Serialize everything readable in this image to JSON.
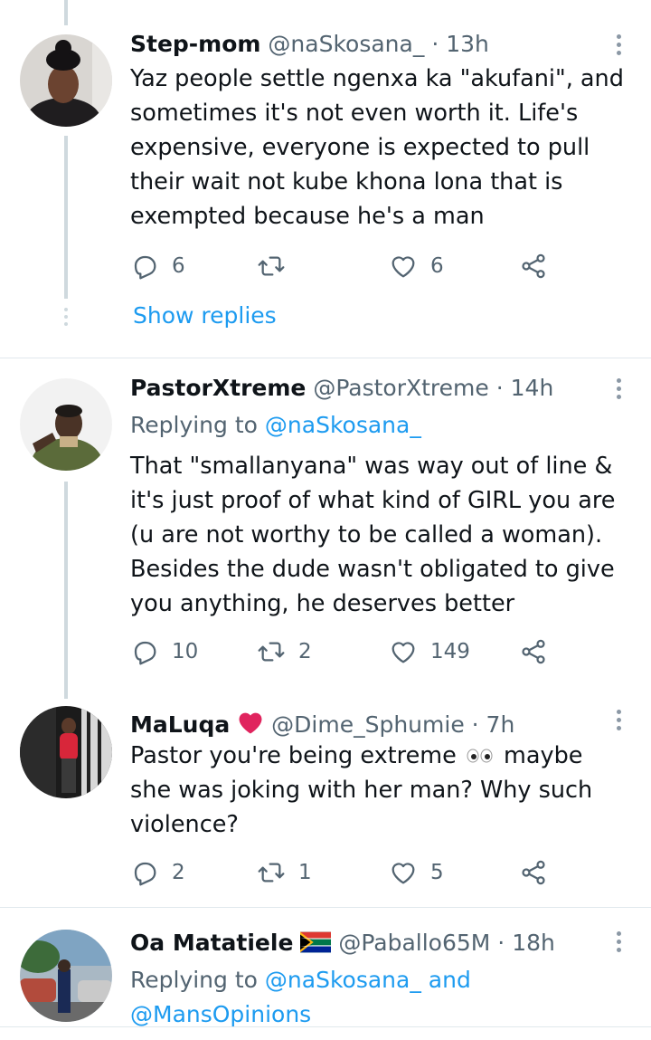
{
  "tweets": [
    {
      "name": "Step-mom",
      "handle": "@naSkosana_",
      "time": "· 13h",
      "text": "Yaz people settle ngenxa ka \"akufani\", and sometimes it's not even worth it. Life's expensive, everyone is expected to pull their wait not kube khona lona that is exempted because he's a man",
      "replies": "6",
      "retweets": "",
      "likes": "6"
    },
    {
      "name": "PastorXtreme",
      "handle": "@PastorXtreme",
      "time": "· 14h",
      "replying_prefix": "Replying to",
      "replying_handle": "@naSkosana_",
      "text": "That \"smallanyana\" was way out of line & it's just proof of what kind of GIRL you are (u are not worthy to be called a woman). Besides the dude wasn't obligated to give you anything, he deserves better",
      "replies": "10",
      "retweets": "2",
      "likes": "149"
    },
    {
      "name": "MaLuqa",
      "name_emoji": "❤",
      "handle": "@Dime_Sphumie",
      "time": "· 7h",
      "text_part1": "Pastor you're being extreme",
      "text_emoji": "👀",
      "text_part2": "maybe she was joking with her man? Why such violence?",
      "replies": "2",
      "retweets": "1",
      "likes": "5"
    },
    {
      "name": "Oa Matatiele",
      "handle": "@Paballo65M",
      "time": "· 18h",
      "replying_prefix": "Replying to",
      "replying_handle": "@naSkosana_ and",
      "replying_handle2": "@MansOpinions"
    }
  ],
  "show_replies": "Show replies",
  "icons": [
    "reply-icon",
    "retweet-icon",
    "like-icon",
    "share-icon",
    "more-icon",
    "heart-emoji",
    "south-africa-flag"
  ],
  "colors": {
    "link": "#1d9bf0",
    "muted": "#536471",
    "heart": "#e0245e"
  }
}
